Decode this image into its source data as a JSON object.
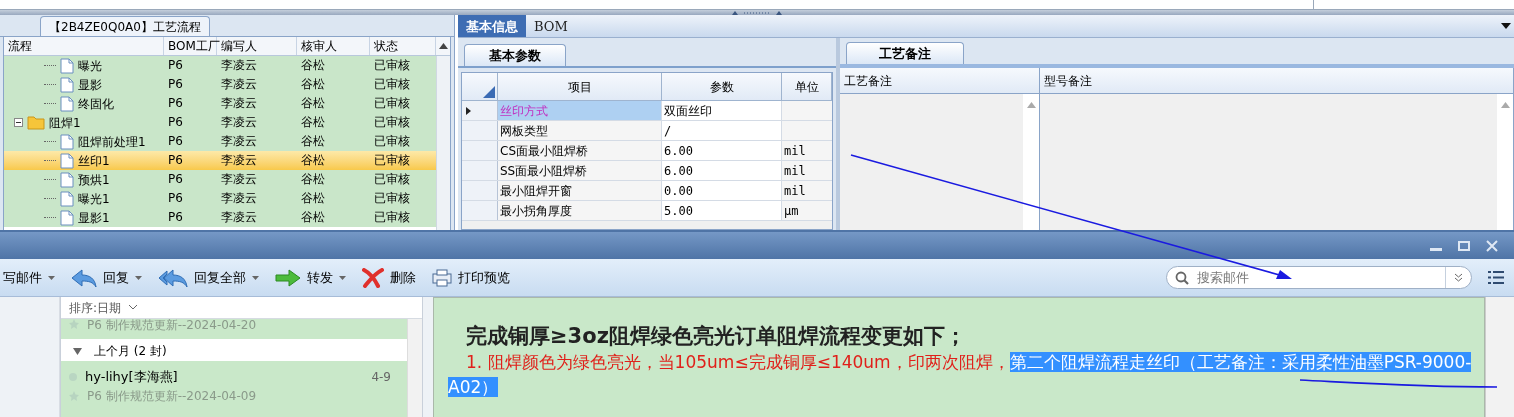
{
  "process_panel": {
    "title": "【2B4ZE0Q0A0】工艺流程",
    "columns": [
      "流程",
      "BOM工厂",
      "编写人",
      "核审人",
      "状态"
    ],
    "tree": [
      {
        "children": [
          {
            "label": "曝光",
            "kind": "file",
            "factory": "P6",
            "author": "李凌云",
            "reviewer": "谷松",
            "status": "已审核",
            "selected": false
          },
          {
            "label": "显影",
            "kind": "file",
            "factory": "P6",
            "author": "李凌云",
            "reviewer": "谷松",
            "status": "已审核",
            "selected": false
          },
          {
            "label": "终固化",
            "kind": "file",
            "factory": "P6",
            "author": "李凌云",
            "reviewer": "谷松",
            "status": "已审核",
            "selected": false
          }
        ]
      },
      {
        "label": "阻焊1",
        "kind": "folder",
        "expanded": true,
        "factory": "P6",
        "author": "李凌云",
        "reviewer": "谷松",
        "status": "已审核",
        "selected": false,
        "children": [
          {
            "label": "阻焊前处理1",
            "kind": "file",
            "factory": "P6",
            "author": "李凌云",
            "reviewer": "谷松",
            "status": "已审核",
            "selected": false
          },
          {
            "label": "丝印1",
            "kind": "file",
            "factory": "P6",
            "author": "李凌云",
            "reviewer": "谷松",
            "status": "已审核",
            "selected": true
          },
          {
            "label": "预烘1",
            "kind": "file",
            "factory": "P6",
            "author": "李凌云",
            "reviewer": "谷松",
            "status": "已审核",
            "selected": false
          },
          {
            "label": "曝光1",
            "kind": "file",
            "factory": "P6",
            "author": "李凌云",
            "reviewer": "谷松",
            "status": "已审核",
            "selected": false
          },
          {
            "label": "显影1",
            "kind": "file",
            "factory": "P6",
            "author": "李凌云",
            "reviewer": "谷松",
            "status": "已审核",
            "selected": false
          }
        ]
      }
    ]
  },
  "detail_tabs": [
    {
      "label": "基本信息",
      "selected": true
    },
    {
      "label": "BOM",
      "selected": false
    }
  ],
  "params_panel": {
    "tab": "基本参数",
    "columns": [
      "项目",
      "参数",
      "单位"
    ],
    "rows": [
      {
        "item": "丝印方式",
        "value": "双面丝印",
        "unit": "",
        "selected": true
      },
      {
        "item": "网板类型",
        "value": "/",
        "unit": "",
        "selected": false
      },
      {
        "item": "CS面最小阻焊桥",
        "value": "6.00",
        "unit": "mil",
        "selected": false
      },
      {
        "item": "SS面最小阻焊桥",
        "value": "6.00",
        "unit": "mil",
        "selected": false
      },
      {
        "item": "最小阻焊开窗",
        "value": "0.00",
        "unit": "mil",
        "selected": false
      },
      {
        "item": "最小拐角厚度",
        "value": "5.00",
        "unit": "μm",
        "selected": false
      }
    ]
  },
  "notes_panel": {
    "tab": "工艺备注",
    "columns": [
      "工艺备注",
      "型号备注"
    ]
  },
  "mail": {
    "toolbar": [
      {
        "kind": "compose",
        "label": "写邮件",
        "menu": true
      },
      {
        "kind": "reply",
        "label": "回复",
        "menu": true
      },
      {
        "kind": "reply_all",
        "label": "回复全部",
        "menu": true
      },
      {
        "kind": "forward",
        "label": "转发",
        "menu": true
      },
      {
        "kind": "delete",
        "label": "删除",
        "menu": false
      },
      {
        "kind": "print",
        "label": "打印预览",
        "menu": false
      }
    ],
    "search": {
      "placeholder": "搜索邮件"
    },
    "list": {
      "sort": "排序:日期",
      "entries": [
        {
          "kind": "preview",
          "subject": "P6 制作规范更新--2024-04-20"
        },
        {
          "kind": "group",
          "label": "上个月 (2 封)",
          "expanded": true
        },
        {
          "kind": "message",
          "sender": "hy-lihy[李海燕]",
          "date": "4-9",
          "subject": "P6 制作规范更新--2024-04-09"
        }
      ]
    },
    "body": {
      "heading": "完成铜厚≥3oz阻焊绿色亮光订单阻焊流程变更如下；",
      "paragraphs": [
        {
          "segments": [
            {
              "text": "1. 阻焊颜色为绿色亮光，当105um≤完成铜厚≤140um，印两次阻焊，",
              "selected": false
            },
            {
              "text": "第二个阻焊流程走丝印（工艺备注：采用柔性油墨PSR-9000-A02）",
              "selected": true
            }
          ]
        }
      ]
    }
  }
}
